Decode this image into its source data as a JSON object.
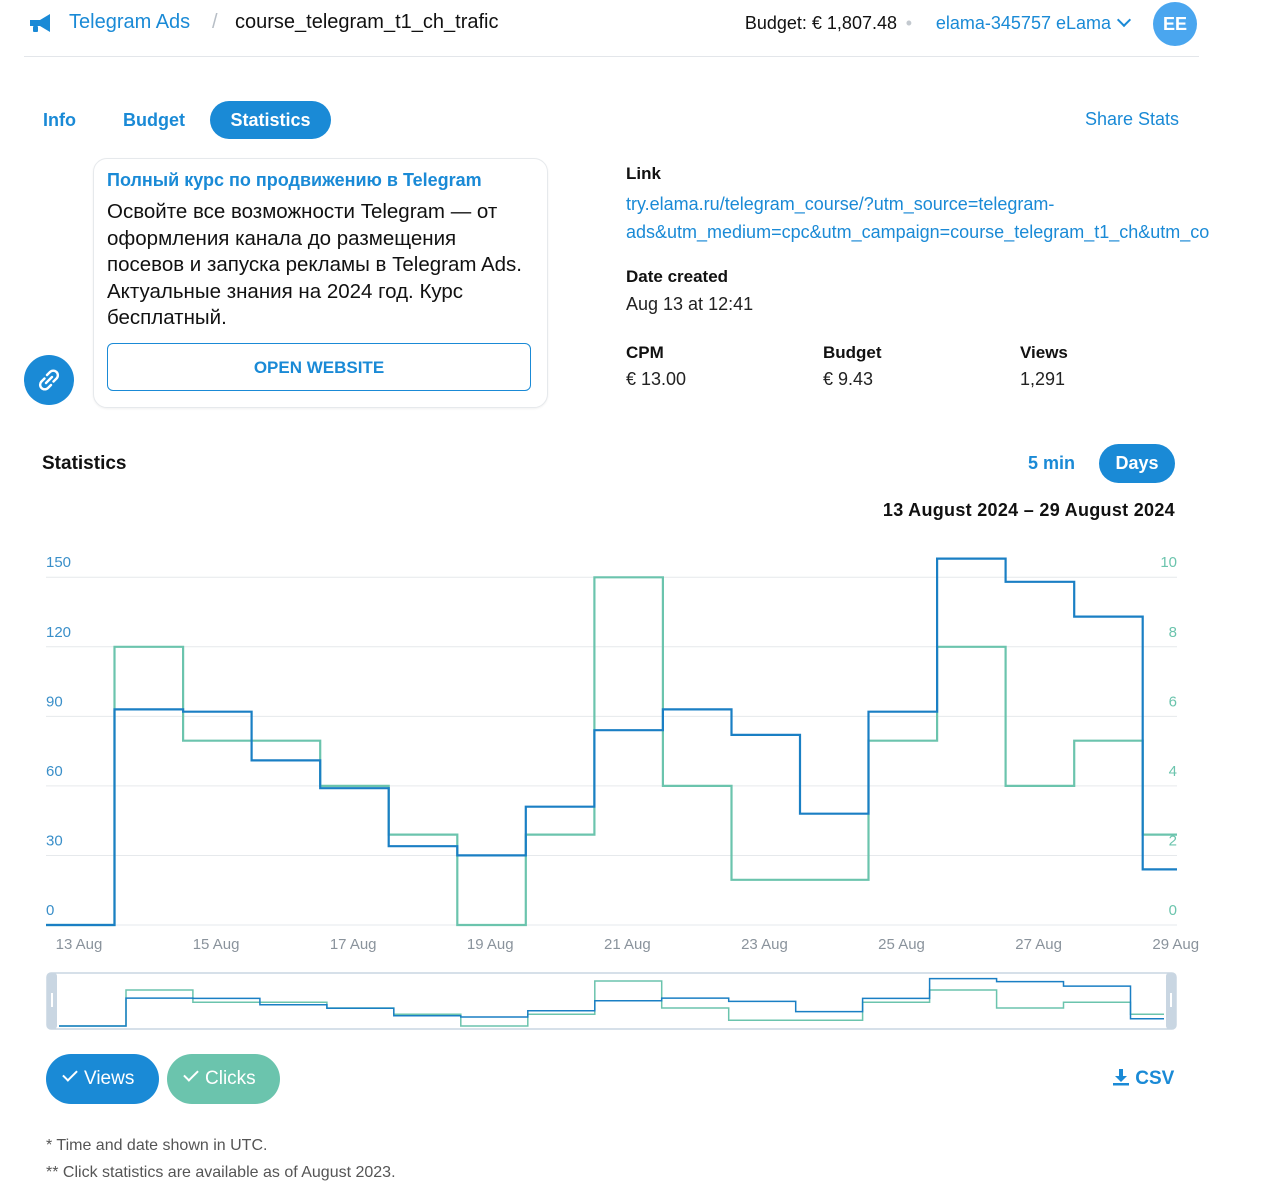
{
  "header": {
    "app_title": "Telegram Ads",
    "separator": "/",
    "campaign": "course_telegram_t1_ch_trafic",
    "budget": "Budget: € 1,807.48",
    "dot": "•",
    "account": "elama-345757 eLama",
    "avatar": "EE"
  },
  "tabs": [
    {
      "label": "Info"
    },
    {
      "label": "Budget"
    },
    {
      "label": "Statistics",
      "active": true
    }
  ],
  "share_label": "Share Stats",
  "ad": {
    "title": "Полный курс по продвижению в Telegram",
    "text": "Освойте все возможности Telegram — от оформления канала до размещения посевов и запуска рекламы в Telegram Ads. Актуальные знания на 2024 год. Курс бесплатный.",
    "button": "OPEN WEBSITE"
  },
  "details": {
    "link_label": "Link",
    "link_line1": "try.elama.ru/telegram_course/?utm_source=telegram-",
    "link_line2": "ads&utm_medium=cpc&utm_campaign=course_telegram_t1_ch&utm_co",
    "date_label": "Date created",
    "date_value": "Aug 13 at 12:41",
    "cpm_label": "CPM",
    "cpm_value": "€ 13.00",
    "budget_label": "Budget",
    "budget_value": "€ 9.43",
    "views_label": "Views",
    "views_value": "1,291"
  },
  "statistics": {
    "title": "Statistics",
    "mode_5min": "5 min",
    "mode_days": "Days",
    "date_range": "13 August 2024 – 29 August 2024"
  },
  "chart_data": {
    "type": "line",
    "x": [
      "13 Aug",
      "14 Aug",
      "15 Aug",
      "16 Aug",
      "17 Aug",
      "18 Aug",
      "19 Aug",
      "20 Aug",
      "21 Aug",
      "22 Aug",
      "23 Aug",
      "24 Aug",
      "25 Aug",
      "26 Aug",
      "27 Aug",
      "28 Aug",
      "29 Aug"
    ],
    "x_tick_labels": [
      "13 Aug",
      "15 Aug",
      "17 Aug",
      "19 Aug",
      "21 Aug",
      "23 Aug",
      "25 Aug",
      "27 Aug",
      "29 Aug"
    ],
    "y_left_ticks": [
      0,
      30,
      60,
      90,
      120,
      150
    ],
    "y_right_ticks": [
      0,
      2,
      4,
      6,
      8,
      10
    ],
    "ylim_left": [
      0,
      160
    ],
    "ylim_right": [
      0,
      10.67
    ],
    "series": [
      {
        "name": "Views",
        "axis": "left",
        "color": "#1a7fc4",
        "values": [
          0,
          93,
          92,
          71,
          59,
          34,
          30,
          51,
          84,
          93,
          82,
          48,
          92,
          158,
          148,
          133,
          24
        ]
      },
      {
        "name": "Clicks",
        "axis": "right",
        "color": "#6bc4ad",
        "values": [
          0,
          8,
          5.3,
          5.3,
          4,
          2.6,
          0,
          2.6,
          10,
          4,
          1.3,
          1.3,
          5.3,
          8,
          4,
          5.3,
          2.6
        ]
      }
    ],
    "grid": true,
    "step": true
  },
  "toggles": {
    "views": "Views",
    "clicks": "Clicks",
    "csv": "CSV"
  },
  "notes": [
    "* Time and date shown in UTC.",
    "** Click statistics are available as of August 2023."
  ],
  "colors": {
    "accent": "#1a8ad6",
    "views": "#1a7fc4",
    "clicks": "#6bc4ad"
  }
}
